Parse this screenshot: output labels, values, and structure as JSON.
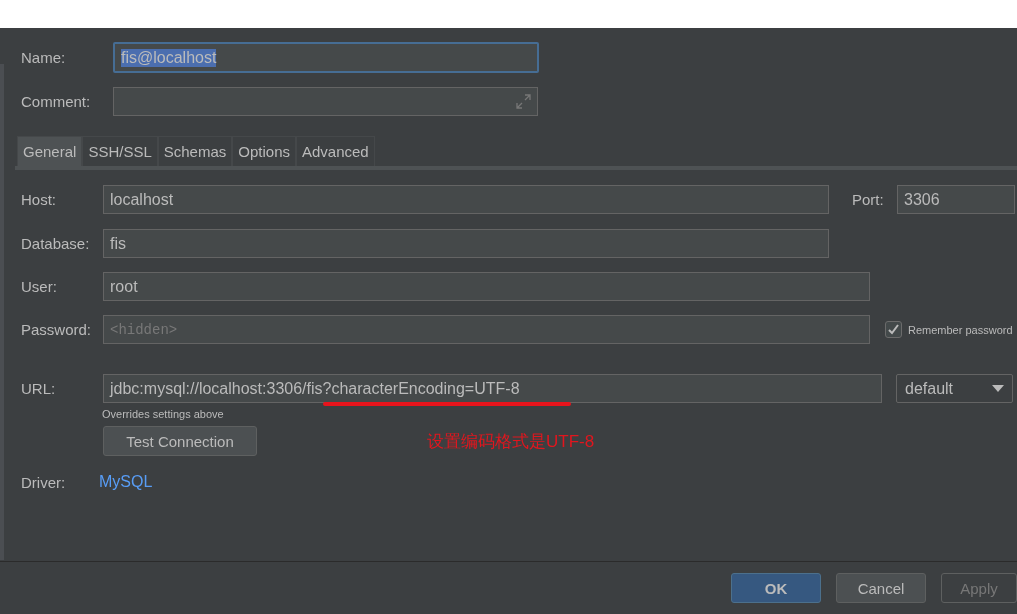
{
  "name": {
    "label": "Name:",
    "value": "fis@localhost",
    "focused": true
  },
  "comment": {
    "label": "Comment:"
  },
  "tabs": [
    {
      "label": "General",
      "selected": true
    },
    {
      "label": "SSH/SSL",
      "selected": false
    },
    {
      "label": "Schemas",
      "selected": false
    },
    {
      "label": "Options",
      "selected": false
    },
    {
      "label": "Advanced",
      "selected": false
    }
  ],
  "host": {
    "label": "Host:",
    "value": "localhost"
  },
  "port": {
    "label": "Port:",
    "value": "3306"
  },
  "database": {
    "label": "Database:",
    "value": "fis"
  },
  "user": {
    "label": "User:",
    "value": "root"
  },
  "password": {
    "label": "Password:",
    "placeholder": "<hidden>"
  },
  "remember_password": {
    "label": "Remember password",
    "checked": true
  },
  "url": {
    "label": "URL:",
    "value": "jdbc:mysql://localhost:3306/fis?characterEncoding=UTF-8",
    "hint": "Overrides settings above",
    "mode": "default"
  },
  "test_connection": "Test Connection",
  "annotation": "设置编码格式是UTF-8",
  "driver": {
    "label": "Driver:",
    "value": "MySQL"
  },
  "buttons": [
    {
      "label": "OK",
      "kind": "primary"
    },
    {
      "label": "Cancel",
      "kind": "normal"
    },
    {
      "label": "Apply",
      "kind": "disabled"
    }
  ]
}
